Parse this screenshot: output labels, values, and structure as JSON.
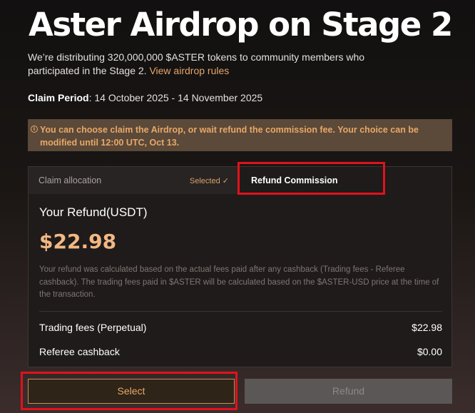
{
  "header": {
    "title": "Aster Airdrop on Stage 2",
    "description": "We’re distributing 320,000,000 $ASTER tokens to community members who participated in the Stage 2.",
    "rules_link": "View airdrop rules",
    "claim_period_label": "Claim Period",
    "claim_period_value": ": 14 October 2025 - 14 November 2025"
  },
  "notice": {
    "icon": "info-icon",
    "text": "You can choose claim the Airdrop, or wait refund the commission fee. Your choice can be modified until 12:00 UTC, Oct 13."
  },
  "tabs": {
    "claim_label": "Claim allocation",
    "selected_label": "Selected ✓",
    "refund_label": "Refund Commission"
  },
  "refund": {
    "heading": "Your Refund(USDT)",
    "amount": "$22.98",
    "note": "Your refund was calculated based on the actual fees paid after any cashback (Trading fees - Referee cashback). The trading fees paid in $ASTER will be calculated based on the $ASTER-USD price at the time of the transaction.",
    "rows": [
      {
        "label": "Trading fees (Perpetual)",
        "value": "$22.98"
      },
      {
        "label": "Referee cashback",
        "value": "$0.00"
      }
    ]
  },
  "actions": {
    "select_label": "Select",
    "refund_label": "Refund"
  },
  "colors": {
    "accent": "#e8a867",
    "highlight": "#e0121c",
    "notice_bg": "#5b4939",
    "panel_bg": "#1f1b1a"
  }
}
